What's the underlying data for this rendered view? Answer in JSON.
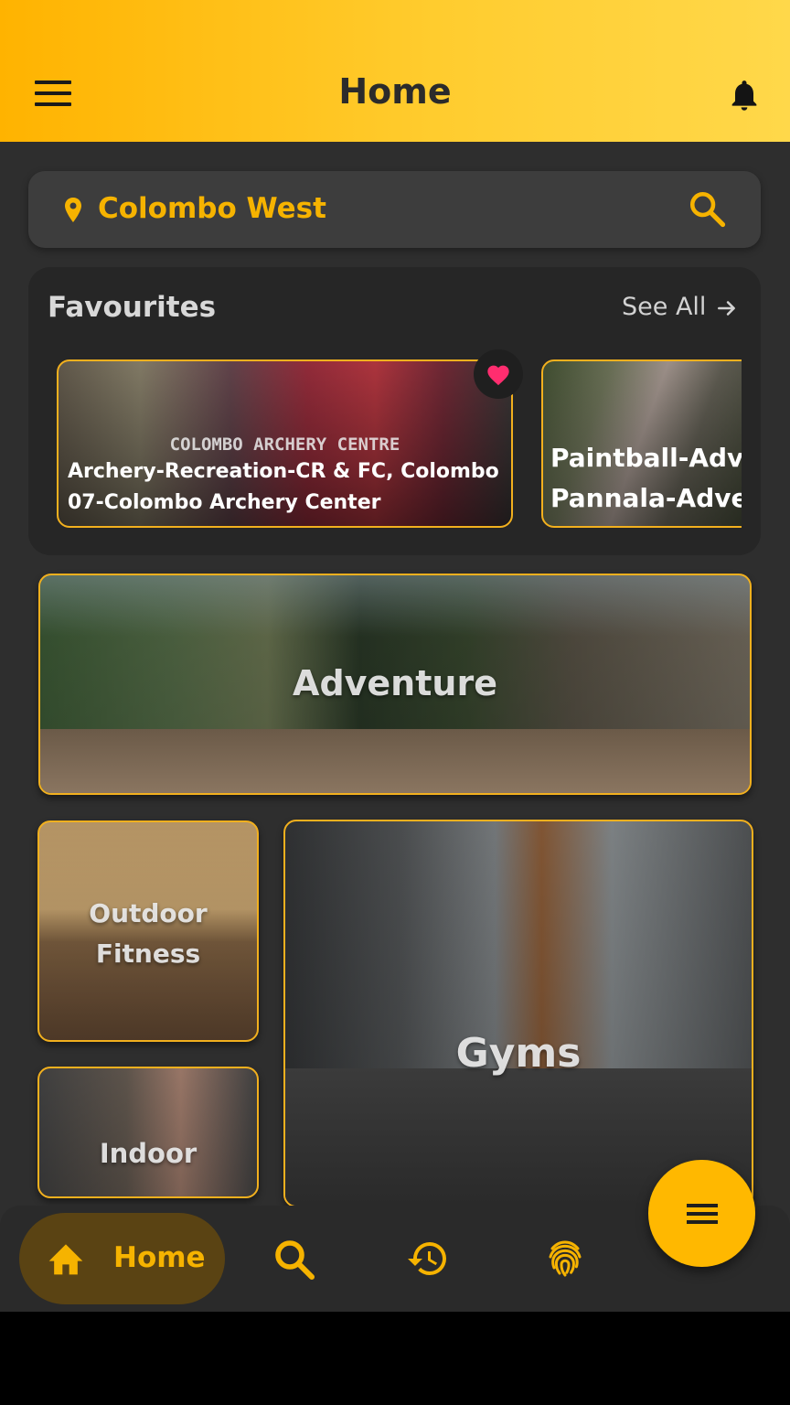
{
  "header": {
    "title": "Home"
  },
  "search": {
    "location": "Colombo West"
  },
  "favourites": {
    "title": "Favourites",
    "see_all": "See All",
    "items": [
      {
        "watermark": "COLOMBO ARCHERY CENTRE",
        "name_line1": "Archery-Recreation-CR & FC, Colombo",
        "name_line2": "07-Colombo Archery Center",
        "favourited": true
      },
      {
        "name_line1": "Paintball-Adv",
        "name_line2": "Pannala-Adve"
      }
    ]
  },
  "categories": {
    "adventure": "Adventure",
    "outdoor_line1": "Outdoor",
    "outdoor_line2": "Fitness",
    "indoor": "Indoor",
    "gyms": "Gyms"
  },
  "bottom_nav": {
    "home_label": "Home"
  },
  "colors": {
    "accent": "#ffb800",
    "header_gradient_start": "#ffb300",
    "header_gradient_end": "#ffd84a",
    "background": "#2e2e2e",
    "heart": "#ff2d6f"
  }
}
